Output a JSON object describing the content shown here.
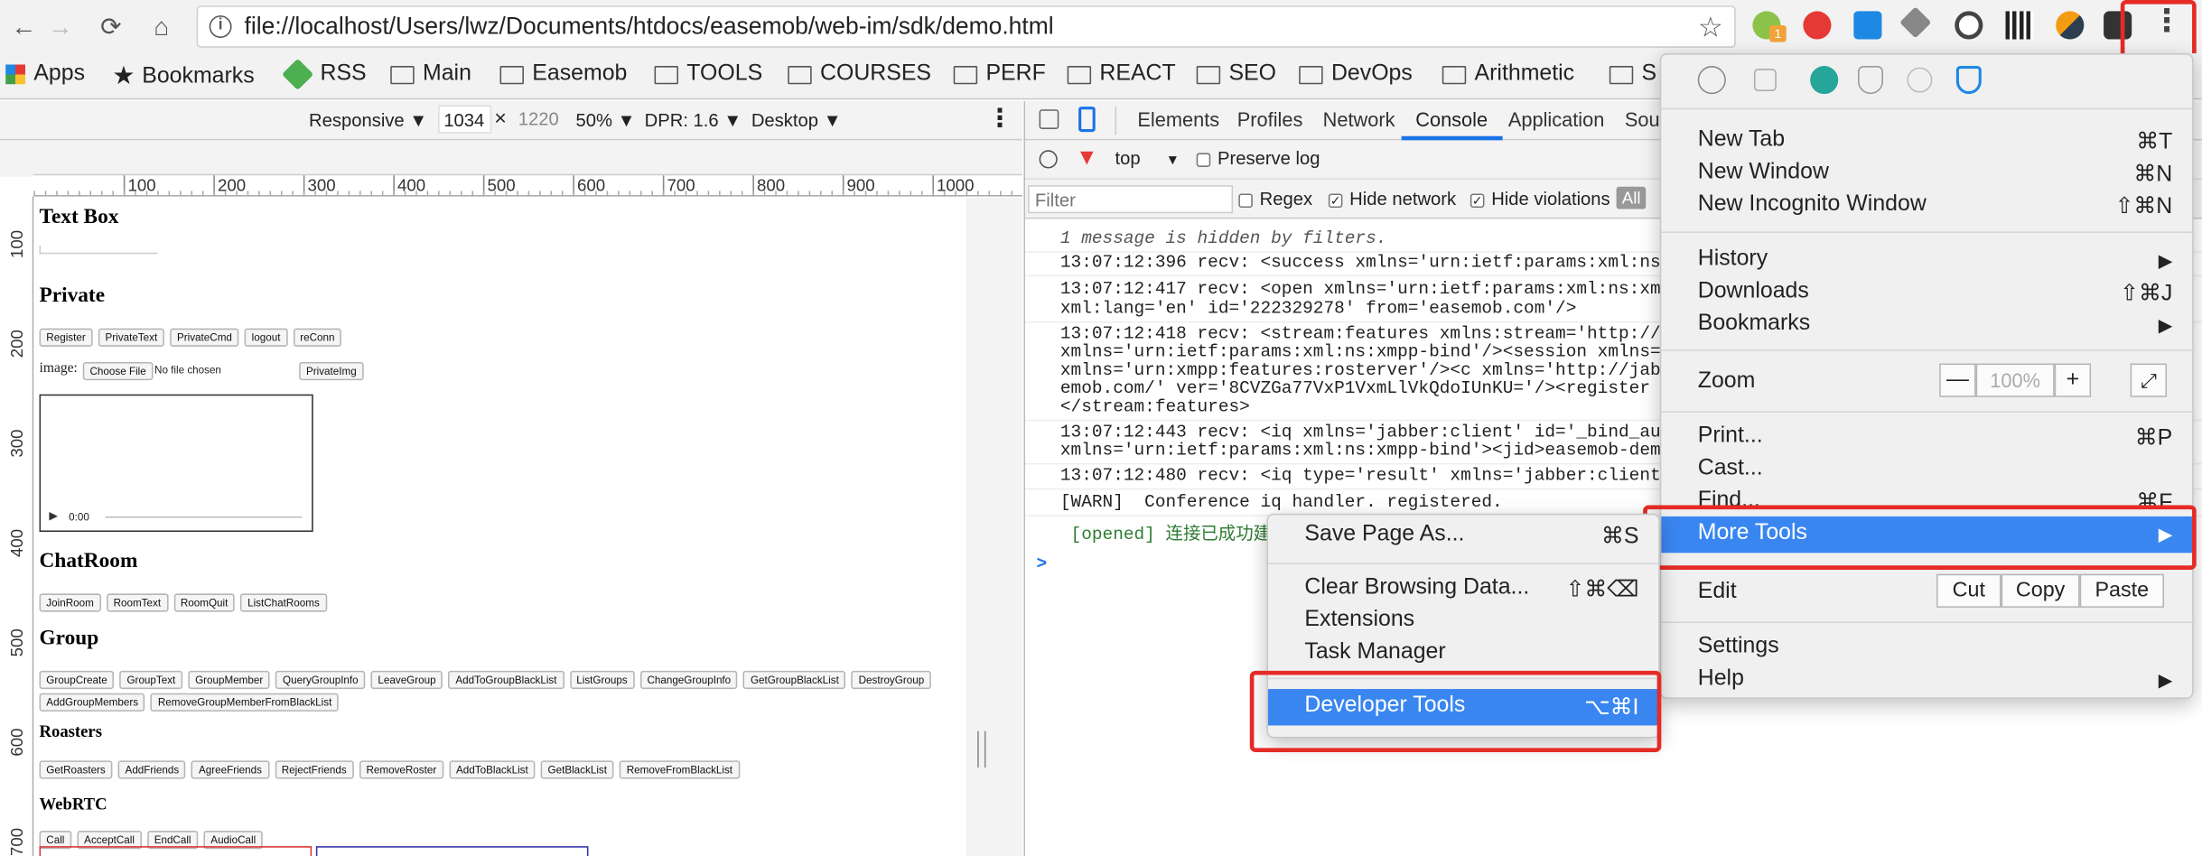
{
  "toolbar": {
    "url": "file://localhost/Users/lwz/Documents/htdocs/easemob/web-im/sdk/demo.html",
    "ext_badge": "1"
  },
  "bookmarks": [
    "Apps",
    "Bookmarks",
    "RSS",
    "Main",
    "Easemob",
    "TOOLS",
    "COURSES",
    "PERF",
    "REACT",
    "SEO",
    "DevOps",
    "Arithmetic",
    "S"
  ],
  "device_toolbar": {
    "mode": "Responsive",
    "width": "1034",
    "times": "×",
    "height": "1220",
    "zoom": "50%",
    "dpr": "DPR: 1.6",
    "type": "Desktop"
  },
  "ruler": {
    "h": [
      "100",
      "200",
      "300",
      "400",
      "500",
      "600",
      "700",
      "800",
      "900",
      "1000"
    ],
    "v": [
      "100",
      "200",
      "300",
      "400",
      "500",
      "600",
      "700"
    ]
  },
  "page": {
    "textbox_title": "Text Box",
    "private_title": "Private",
    "private_buttons": [
      "Register",
      "PrivateText",
      "PrivateCmd",
      "logout",
      "reConn"
    ],
    "image_label": "image:",
    "choose_file": "Choose File",
    "no_file": "No file chosen",
    "private_img": "PrivateImg",
    "audio_time": "0:00",
    "chatroom_title": "ChatRoom",
    "chatroom_buttons": [
      "JoinRoom",
      "RoomText",
      "RoomQuit",
      "ListChatRooms"
    ],
    "group_title": "Group",
    "group_buttons": [
      "GroupCreate",
      "GroupText",
      "GroupMember",
      "QueryGroupInfo",
      "LeaveGroup",
      "AddToGroupBlackList",
      "ListGroups",
      "ChangeGroupInfo",
      "GetGroupBlackList",
      "DestroyGroup",
      "AddGroupMembers",
      "RemoveGroupMemberFromBlackList"
    ],
    "roasters_title": "Roasters",
    "roasters_buttons": [
      "GetRoasters",
      "AddFriends",
      "AgreeFriends",
      "RejectFriends",
      "RemoveRoster",
      "AddToBlackList",
      "GetBlackList",
      "RemoveFromBlackList"
    ],
    "webrtc_title": "WebRTC",
    "webrtc_buttons": [
      "Call",
      "AcceptCall",
      "EndCall",
      "AudioCall"
    ]
  },
  "devtools": {
    "tabs": [
      "Elements",
      "Profiles",
      "Network",
      "Console",
      "Application",
      "Sou"
    ],
    "context": "top",
    "preserve_log": "Preserve log",
    "filter_placeholder": "Filter",
    "regex": "Regex",
    "hide_network": "Hide network",
    "hide_violations": "Hide violations",
    "all": "All",
    "lines": [
      "1 message is hidden by filters.",
      "13:07:12:396 recv: <success xmlns='urn:ietf:params:xml:ns:xmpp",
      "13:07:12:417 recv: <open xmlns='urn:ietf:params:xml:ns:xmpp-f",
      "xml:lang='en' id='222329278' from='easemob.com'/>",
      "13:07:12:418 recv: <stream:features xmlns:stream='http://ethe",
      "xmlns='urn:ietf:params:xml:ns:xmpp-bind'/><session xmlns='urn",
      "xmlns='urn:xmpp:features:rosterver'/><c xmlns='http://jabber.",
      "emob.com/' ver='8CVZGa77VxP1VxmLlVkQdoIUnKU='/><register xmlns",
      "</stream:features>",
      "13:07:12:443 recv: <iq xmlns='jabber:client' id='_bind_auth_2",
      "xmlns='urn:ietf:params:xml:ns:xmpp-bind'><jid>easemob-demo#ch",
      "13:07:12:480 recv: <iq type='result' xmlns='jabber:client' id",
      "[WARN]  Conference iq handler. registered.",
      " [opened] 连接已成功建立"
    ],
    "prompt": ">"
  },
  "menu": {
    "new_tab": "New Tab",
    "new_tab_sc": "⌘T",
    "new_window": "New Window",
    "new_window_sc": "⌘N",
    "incognito": "New Incognito Window",
    "incognito_sc": "⇧⌘N",
    "history": "History",
    "downloads": "Downloads",
    "downloads_sc": "⇧⌘J",
    "bookmarks": "Bookmarks",
    "zoom": "Zoom",
    "zoom_minus": "—",
    "zoom_value": "100%",
    "zoom_plus": "+",
    "print": "Print...",
    "print_sc": "⌘P",
    "cast": "Cast...",
    "find": "Find...",
    "find_sc": "⌘F",
    "more_tools": "More Tools",
    "edit": "Edit",
    "cut": "Cut",
    "copy": "Copy",
    "paste": "Paste",
    "settings": "Settings",
    "help": "Help",
    "arrow": "▶"
  },
  "submenu": {
    "save_page": "Save Page As...",
    "save_page_sc": "⌘S",
    "clear_browsing": "Clear Browsing Data...",
    "clear_browsing_sc": "⇧⌘⌫",
    "extensions": "Extensions",
    "task_manager": "Task Manager",
    "developer_tools": "Developer Tools",
    "developer_tools_sc": "⌥⌘I"
  },
  "colors": {
    "highlight": "#3a86f0",
    "annotation": "#e52b25"
  }
}
